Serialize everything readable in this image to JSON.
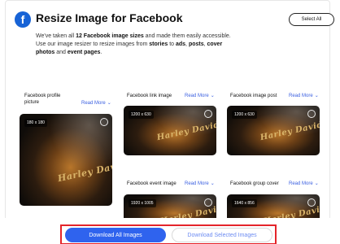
{
  "header": {
    "icon": "facebook-icon",
    "icon_glyph": "f",
    "title": "Resize Image for Facebook",
    "select_all_label": "Select All"
  },
  "description": {
    "t1": "We've taken all ",
    "b1": "12 Facebook image sizes",
    "t2": " and made them easily accessible. Use our image resizer to resize images from ",
    "b2": "stories",
    "t3": " to ",
    "b3": "ads",
    "t4": ", ",
    "b4": "posts",
    "t5": ", ",
    "b5": "cover photos",
    "t6": " and ",
    "b6": "event pages",
    "t7": "."
  },
  "tiles": [
    {
      "label": "Facebook profile picture",
      "read_more": "Read More",
      "size": "180 x 180",
      "logo": "Harley Davidson"
    },
    {
      "label": "Facebook link image",
      "read_more": "Read More",
      "size": "1200 x 630",
      "logo": "Harley Davidson"
    },
    {
      "label": "Facebook image post",
      "read_more": "Read More",
      "size": "1200 x 630",
      "logo": "Harley Davidson"
    },
    {
      "label": "Facebook event image",
      "read_more": "Read More",
      "size": "1920 x 1005",
      "logo": "Harley Davidson"
    },
    {
      "label": "Facebook group cover",
      "read_more": "Read More",
      "size": "1640 x 856",
      "logo": "Harley Davidson"
    }
  ],
  "footer": {
    "download_all_label": "Download All Images",
    "download_selected_label": "Download Selected Images"
  },
  "colors": {
    "accent": "#2f63ee",
    "facebook": "#1763d6",
    "link": "#3a5fe0",
    "highlight": "#e4242a"
  }
}
